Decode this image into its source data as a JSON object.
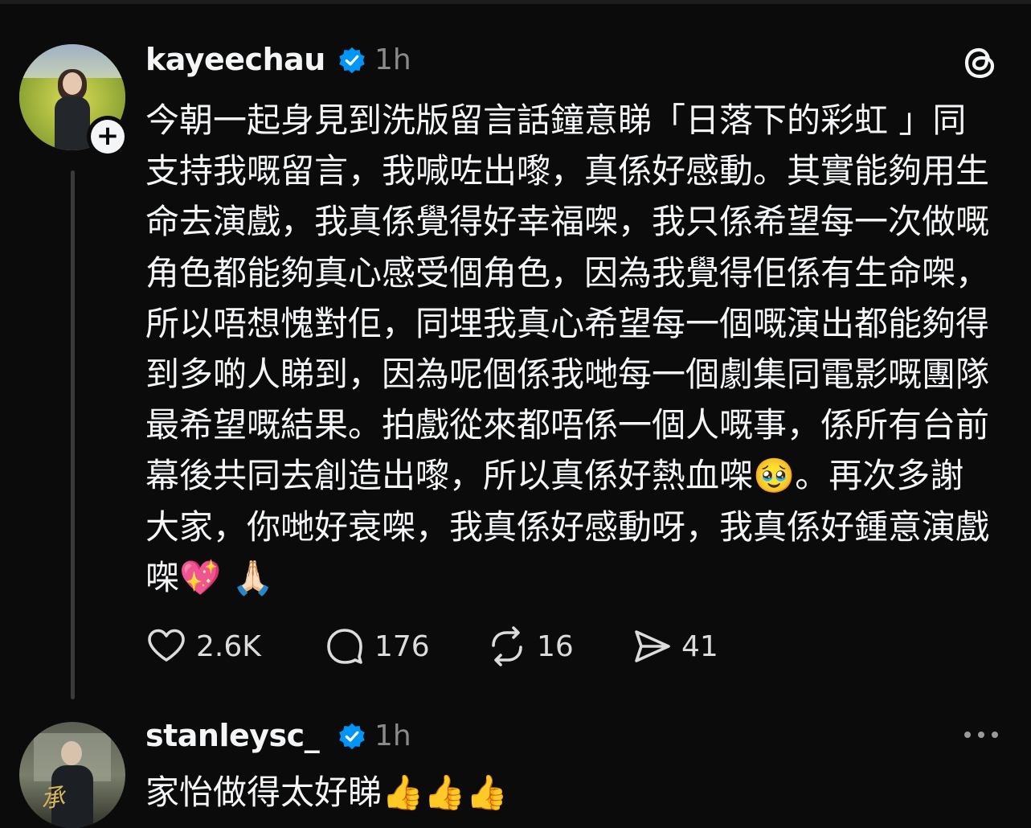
{
  "post": {
    "username": "kayeechau",
    "time": "1h",
    "text": "今朝一起身見到洗版留言話鐘意睇「日落下的彩虹 」同支持我嘅留言，我喊咗出嚟，真係好感動。其實能夠用生命去演戲，我真係覺得好幸福㗎，我只係希望每一次做嘅角色都能夠真心感受個角色，因為我覺得佢係有生命㗎，所以唔想愧對佢，同埋我真心希望每一個嘅演出都能夠得到多啲人睇到，因為呢個係我哋每一個劇集同電影嘅團隊最希望嘅結果。拍戲從來都唔係一個人嘅事，係所有台前幕後共同去創造出嚟，所以真係好熱血㗎🥹。再次多謝大家，你哋好衰㗎，我真係好感動呀，我真係好鍾意演戲㗎💖 🙏🏻",
    "actions": {
      "likes": "2.6K",
      "replies": "176",
      "reposts": "16",
      "shares": "41"
    }
  },
  "reply": {
    "username": "stanleysc_",
    "time": "1h",
    "text": "家怡做得太好睇👍👍👍",
    "avatar_text": "承"
  },
  "colors": {
    "background": "#0b0b0b",
    "text": "#f3f5f7",
    "muted": "#8a8a8a",
    "verified": "#0095f6"
  }
}
